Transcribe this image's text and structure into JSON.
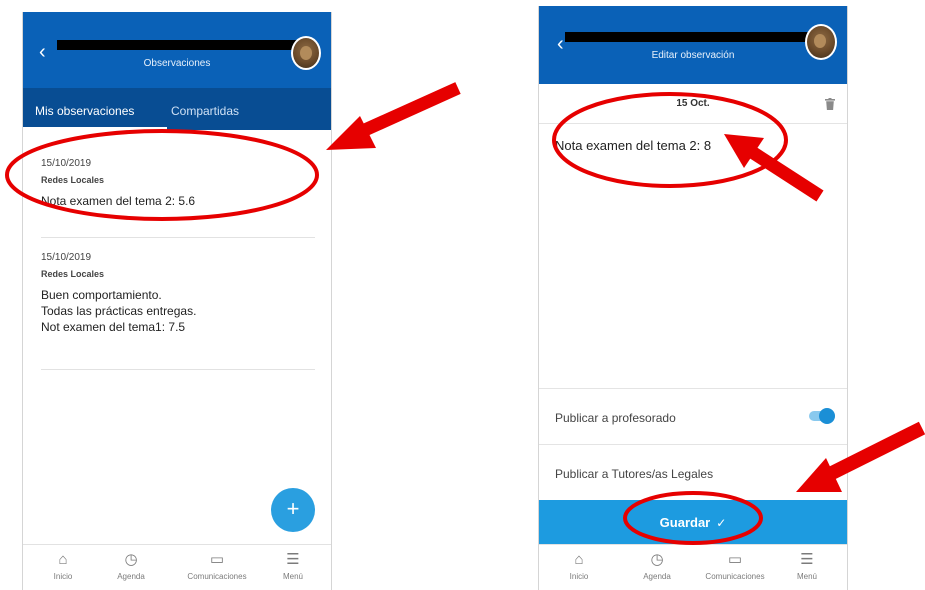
{
  "left_screen": {
    "header": {
      "subtitle": "Observaciones"
    },
    "tabs": [
      {
        "label": "Mis observaciones"
      },
      {
        "label": "Compartidas"
      }
    ],
    "observations": [
      {
        "date": "15/10/2019",
        "subject": "Redes Locales",
        "lines": [
          "Nota examen del tema 2: 5.6"
        ]
      },
      {
        "date": "15/10/2019",
        "subject": "Redes Locales",
        "lines": [
          "Buen comportamiento.",
          "Todas las prácticas entregas.",
          "Not examen del tema1:  7.5"
        ]
      }
    ],
    "fab_label": "+"
  },
  "right_screen": {
    "header": {
      "subtitle": "Editar observación"
    },
    "date_label": "15 Oct.",
    "note": "Nota examen del tema 2: 8",
    "options": [
      {
        "label": "Publicar a profesorado",
        "enabled": true
      },
      {
        "label": "Publicar a Tutores/as Legales"
      }
    ],
    "save_label": "Guardar",
    "save_icon": "✓"
  },
  "bottom_nav": [
    {
      "label": "Inicio",
      "icon": "home-icon"
    },
    {
      "label": "Agenda",
      "icon": "clock-icon"
    },
    {
      "label": "Comunicaciones",
      "icon": "chat-icon"
    },
    {
      "label": "Menú",
      "icon": "menu-icon"
    }
  ],
  "colors": {
    "header": "#0a61b7",
    "tabs": "#084d93",
    "accent": "#1d9be0",
    "annotation": "#e60000"
  }
}
